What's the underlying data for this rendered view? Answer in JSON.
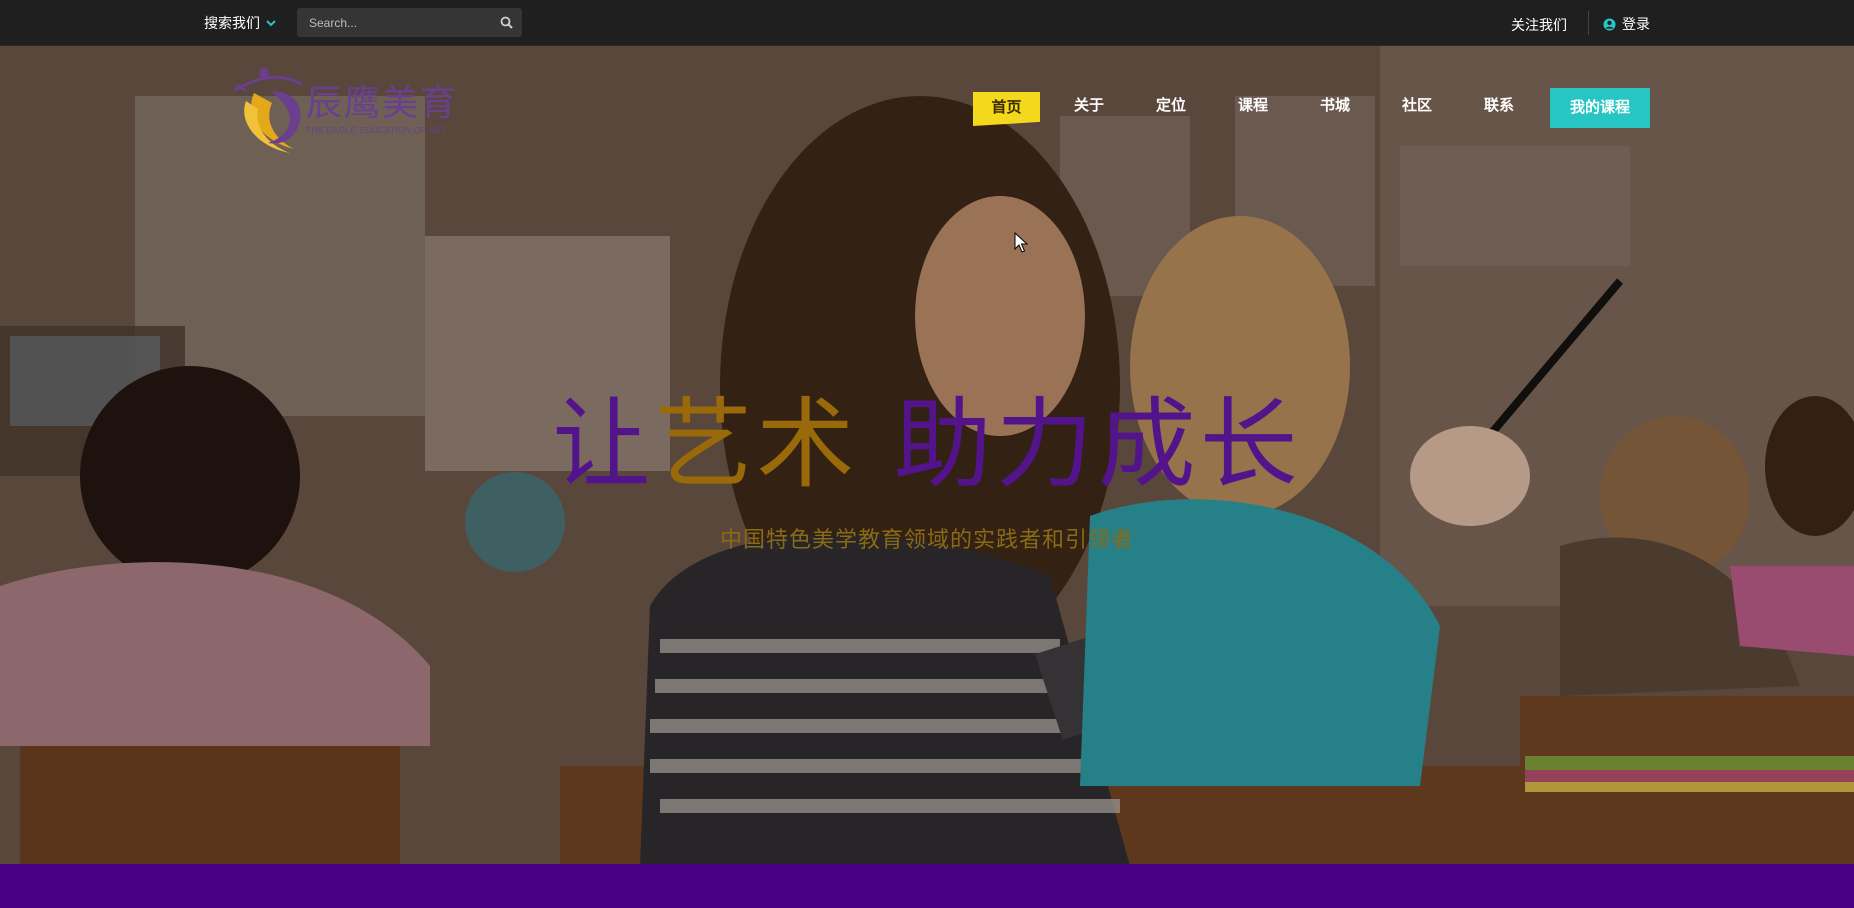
{
  "topbar": {
    "search_menu_label": "搜索我们",
    "search_placeholder": "Search...",
    "follow_label": "关注我们",
    "login_label": "登录"
  },
  "logo": {
    "cn": "辰鹰美育",
    "en": "THE EAGLE EDUCATION OF ART"
  },
  "nav": {
    "items": [
      {
        "label": "首页"
      },
      {
        "label": "关于"
      },
      {
        "label": "定位"
      },
      {
        "label": "课程"
      },
      {
        "label": "书城"
      },
      {
        "label": "社区"
      },
      {
        "label": "联系"
      },
      {
        "label": "我的课程"
      }
    ]
  },
  "hero": {
    "headline_part1": "让",
    "headline_part2": "艺术",
    "headline_part3": "助力成长",
    "subline": "中国特色美学教育领域的实践者和引领者"
  },
  "colors": {
    "accent_teal": "#27c5c3",
    "home_yellow": "#f4d81b",
    "brand_purple": "#4a0083",
    "headline_gold": "#9a6a0a"
  },
  "icons": {
    "search_menu": "chevron-down-icon",
    "search": "search-icon",
    "login": "user-circle-icon"
  }
}
